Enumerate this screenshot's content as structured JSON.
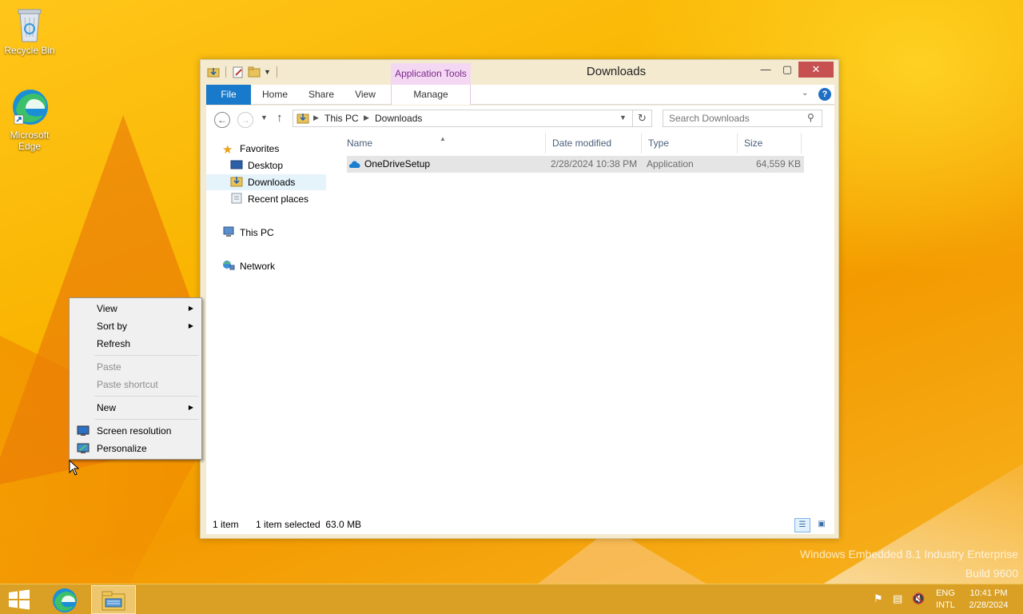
{
  "desktop": {
    "icons": [
      {
        "label": "Recycle Bin",
        "icon": "recycle-bin-icon"
      },
      {
        "label": "Microsoft Edge",
        "icon": "edge-icon"
      }
    ],
    "watermark": {
      "line1": "Windows Embedded 8.1 Industry Enterprise",
      "line2": "Build 9600"
    }
  },
  "explorer": {
    "title": "Downloads",
    "context_tab": "Application Tools",
    "ribbon_tabs": {
      "file": "File",
      "home": "Home",
      "share": "Share",
      "view": "View",
      "manage": "Manage"
    },
    "address": {
      "crumbs": [
        "This PC",
        "Downloads"
      ]
    },
    "search": {
      "placeholder": "Search Downloads"
    },
    "nav_pane": {
      "favorites": "Favorites",
      "desktop": "Desktop",
      "downloads": "Downloads",
      "recent_places": "Recent places",
      "this_pc": "This PC",
      "network": "Network"
    },
    "columns": {
      "name": "Name",
      "date_modified": "Date modified",
      "type": "Type",
      "size": "Size"
    },
    "files": [
      {
        "name": "OneDriveSetup",
        "date_modified": "2/28/2024 10:38 PM",
        "type": "Application",
        "size": "64,559 KB",
        "icon": "onedrive-icon"
      }
    ],
    "status": {
      "item_count": "1 item",
      "selection": "1 item selected  63.0 MB"
    }
  },
  "context_menu": {
    "view": "View",
    "sort_by": "Sort by",
    "refresh": "Refresh",
    "paste": "Paste",
    "paste_shortcut": "Paste shortcut",
    "new": "New",
    "screen_resolution": "Screen resolution",
    "personalize": "Personalize"
  },
  "taskbar": {
    "apps": [
      "start-icon",
      "edge-icon",
      "file-explorer-icon"
    ],
    "language": {
      "line1": "ENG",
      "line2": "INTL"
    },
    "clock": {
      "time": "10:41 PM",
      "date": "2/28/2024"
    }
  },
  "colors": {
    "accent_blue": "#1979ca",
    "app_tools_tab": "#f4d7f3",
    "close_button": "#c75050",
    "selection": "#e5f3fb"
  }
}
